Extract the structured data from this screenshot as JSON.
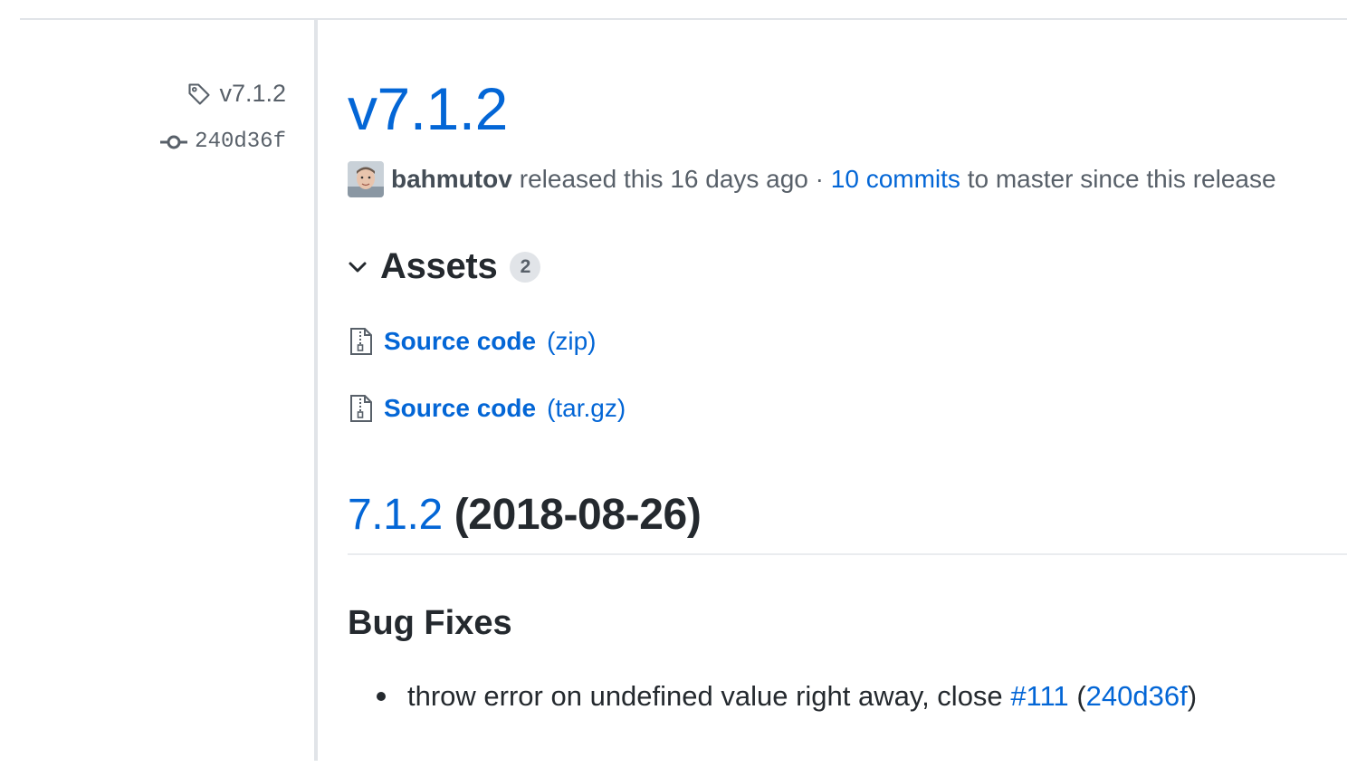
{
  "sidebar": {
    "tag": "v7.1.2",
    "commit": "240d36f"
  },
  "release": {
    "title": "v7.1.2",
    "author": "bahmutov",
    "released_text": "released this 16 days ago",
    "separator": "·",
    "commits_link": "10 commits",
    "commits_suffix": "to master since this release"
  },
  "assets": {
    "title": "Assets",
    "count": "2",
    "items": [
      {
        "name": "Source code",
        "ext": "(zip)"
      },
      {
        "name": "Source code",
        "ext": "(tar.gz)"
      }
    ]
  },
  "notes": {
    "version_link": "7.1.2",
    "version_date": "(2018-08-26)",
    "section_title": "Bug Fixes",
    "items": [
      {
        "text": "throw error on undefined value right away, close",
        "issue": "#111",
        "open_paren": "(",
        "commit": "240d36f",
        "close_paren": ")"
      }
    ]
  },
  "colors": {
    "link": "#0366d6",
    "text": "#24292e",
    "muted": "#586069"
  }
}
